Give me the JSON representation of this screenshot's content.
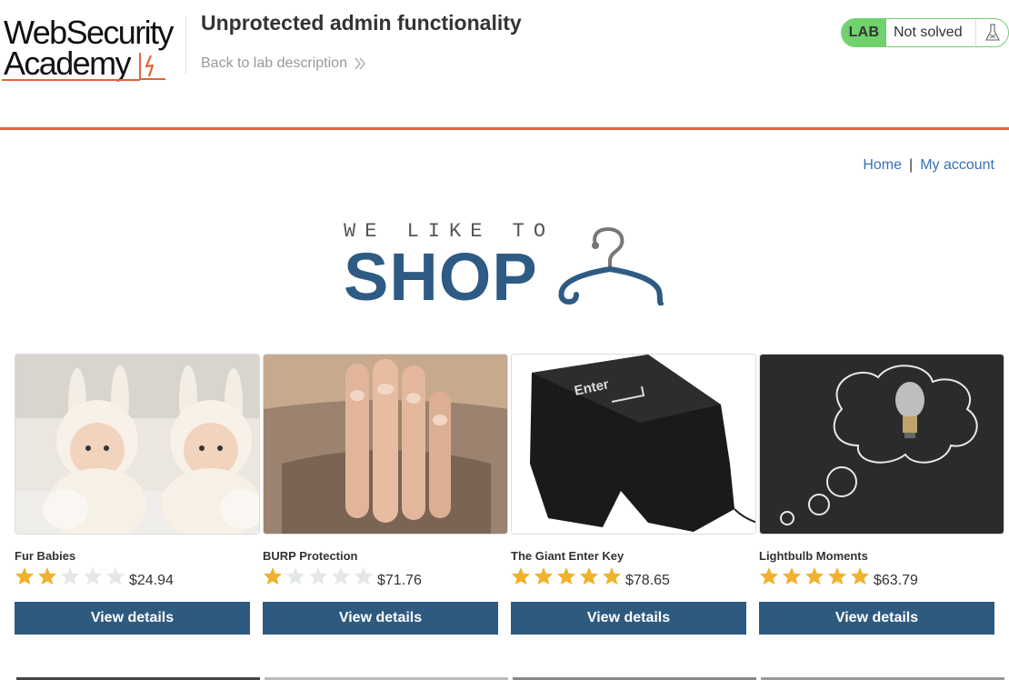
{
  "header": {
    "logo_line1": "WebSecurity",
    "logo_line2": "Academy",
    "lab_title": "Unprotected admin functionality",
    "back_link": "Back to lab description",
    "status_lab": "LAB",
    "status_text": "Not solved"
  },
  "nav": {
    "home": "Home",
    "separator": "|",
    "account": "My account"
  },
  "banner": {
    "small": "WE LIKE TO",
    "big": "SHOP"
  },
  "colors": {
    "accent": "#e2643d",
    "button": "#2f5a80",
    "link": "#3571b5",
    "lab_green": "#70d16d",
    "star": "#f0b22c"
  },
  "products": [
    {
      "name": "Fur Babies",
      "rating": 2,
      "price": "$24.94",
      "button": "View details"
    },
    {
      "name": "BURP Protection",
      "rating": 1,
      "price": "$71.76",
      "button": "View details"
    },
    {
      "name": "The Giant Enter Key",
      "rating": 5,
      "price": "$78.65",
      "button": "View details"
    },
    {
      "name": "Lightbulb Moments",
      "rating": 5,
      "price": "$63.79",
      "button": "View details"
    }
  ]
}
